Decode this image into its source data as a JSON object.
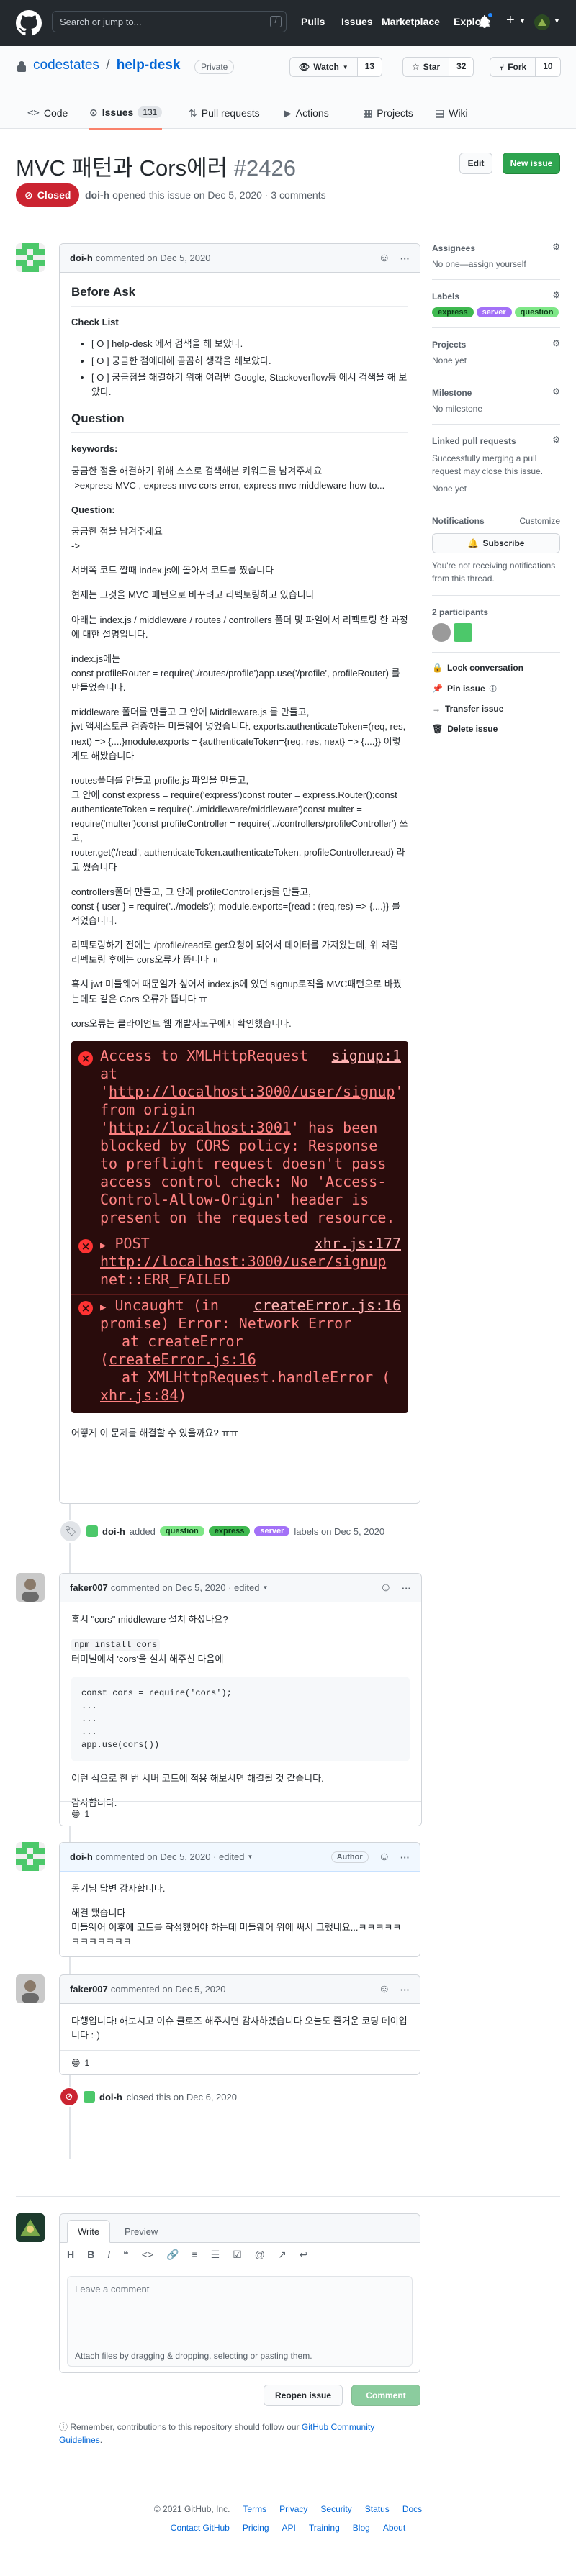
{
  "header": {
    "search_placeholder": "Search or jump to...",
    "search_key": "/",
    "nav": [
      "Pulls",
      "Issues",
      "Marketplace",
      "Explore"
    ]
  },
  "repo": {
    "owner": "codestates",
    "separator": "/",
    "name": "help-desk",
    "visibility": "Private",
    "watch_label": "Watch",
    "watch_count": "13",
    "star_label": "Star",
    "star_count": "32",
    "fork_label": "Fork",
    "fork_count": "10",
    "tabs": [
      {
        "label": "Code"
      },
      {
        "label": "Issues",
        "count": "131"
      },
      {
        "label": "Pull requests"
      },
      {
        "label": "Actions"
      },
      {
        "label": "Projects"
      },
      {
        "label": "Wiki"
      }
    ]
  },
  "issue": {
    "title": "MVC 패턴과 Cors에러",
    "number": "#2426",
    "edit_label": "Edit",
    "new_issue_label": "New issue",
    "state": "Closed",
    "author": "doi-h",
    "meta_text": "opened this issue on Dec 5, 2020 · 3 comments"
  },
  "main_comment": {
    "author": "doi-h",
    "action": "commented on Dec 5, 2020",
    "h_before": "Before Ask",
    "h_checklist": "Check List",
    "checklist": [
      "[ O ] help-desk 에서 검색을 해 보았다.",
      "[ O ] 궁금한 점에대해 곰곰히 생각을 해보았다.",
      "[ O ] 궁금점을 해결하기 위해 여러번 Google, Stackoverflow등 에서 검색을 해 보았다."
    ],
    "h_question": "Question",
    "keywords_label": "keywords:",
    "keywords_text": "궁금한 점을 해결하기 위해 스스로 검색해본 키워드를 남겨주세요",
    "keywords_arrow": "->",
    "keywords_value": "express MVC , express mvc cors error, express mvc middleware how to...",
    "question_label": "Question:",
    "q_intro": "궁금한 점을 남겨주세요",
    "q_arrow": "->",
    "paragraphs": [
      "서버쪽 코드 짤때 index.js에 몰아서 코드를 짰습니다",
      "현재는 그것을 MVC 패턴으로 바꾸려고 리펙토링하고 있습니다",
      "아래는 index.js / middleware / routes / controllers 폴더 및 파일에서 리펙토링 한 과정에 대한 설명입니다.",
      "index.js에는\nconst profileRouter = require('./routes/profile')app.use('/profile', profileRouter) 를 만들었습니다.",
      "middleware 폴더를 만들고 그 안에 Middleware.js 를 만들고,\njwt 액세스토큰 검증하는 미들웨어 넣었습니다. exports.authenticateToken=(req, res, next) => {....}module.exports = {authenticateToken={req, res, next} => {....}} 이렇게도 해봤습니다",
      "routes폴더를 만들고 profile.js 파일을 만들고,\n그 안에 const express = require('express')const router = express.Router();const authenticateToken = require('../middleware/middleware')const multer = require('multer')const profileController = require('../controllers/profileController') 쓰고,\nrouter.get('/read', authenticateToken.authenticateToken, profileController.read) 라고 썼습니다",
      "controllers폴더 만들고, 그 안에 profileController.js를 만들고,\nconst { user } = require('../models'); module.exports={read : (req,res) => {....}} 를 적었습니다.",
      "리펙토링하기 전에는 /profile/read로 get요청이 되어서 데이터를 가져왔는데, 위 처럼 리펙토링 후에는 cors오류가 뜹니다 ㅠ",
      "혹시 jwt 미들웨어 때문일가 싶어서 index.js에 있던 signup로직을 MVC패턴으로 바꿨는데도 같은 Cors 오류가 뜹니다 ㅠ",
      "cors오류는 클라이언트 웹 개발자도구에서 확인했습니다."
    ],
    "console": {
      "err1_pre": "Access to",
      "err1_link": "signup:1",
      "err1_xhr": "XMLHttpRequest at '",
      "err1_url": "http://localhost:3000/user/signup",
      "err1_mid": "' from origin '",
      "err1_origin": "http://localhost:3001",
      "err1_post": "' has been blocked by CORS policy: Response to preflight request doesn't pass access control check: No 'Access-Control-Allow-Origin' header is present on the requested resource.",
      "err2_method": "POST",
      "err2_url": "http://localhost:3000/user/signup",
      "err2_link": "xhr.js:177",
      "err2_tail": "net::ERR_FAILED",
      "err3_pre": "Uncaught (in",
      "err3_link": "createError.js:16",
      "err3_line2": "promise) Error: Network Error",
      "err3_line3": "at createError (",
      "err3_link2": "createError.js:16",
      "err3_line4": "at XMLHttpRequest.handleError (",
      "err3_link3": "xhr.js:84",
      "err3_close": ")"
    },
    "closing": "어떻게 이 문제를 해결할 수 있을까요? ㅠㅠ"
  },
  "label_event": {
    "author": "doi-h",
    "added": "added",
    "labels": [
      {
        "name": "question",
        "color": "#7ee787"
      },
      {
        "name": "express",
        "color": "#3fb950"
      },
      {
        "name": "server",
        "color": "#a371f7"
      }
    ],
    "suffix": "labels on Dec 5, 2020"
  },
  "comment2": {
    "author": "faker007",
    "action": "commented on Dec 5, 2020 · edited",
    "p1": "혹시 \"cors\" middleware 설치 하셨나요?",
    "code_inline": "npm install cors",
    "p2": "터미널에서 'cors'을 설치 해주신 다음에",
    "code_block": "const cors = require('cors');\n...\n...\n...\napp.use(cors())",
    "p3": "이런 식으로 한 번 서버 코드에 적용 해보시면 해결될 것 같습니다.",
    "p4": "감사합니다.",
    "reaction_emoji": "😄",
    "reaction_count": "1"
  },
  "comment3": {
    "author": "doi-h",
    "action": "commented on Dec 5, 2020 · edited",
    "badge": "Author",
    "p1": "동기님 답변 감사합니다.",
    "p2": "해결 됐습니다\n미들웨어 이후에 코드를 작성했어야 하는데 미들웨어 위에 써서 그랬네요...ㅋㅋㅋㅋㅋㅋㅋㅋㅋㅋㅋㅋ"
  },
  "comment4": {
    "author": "faker007",
    "action": "commented on Dec 5, 2020",
    "p1": "다행입니다! 해보시고 이슈 클로즈 해주시면 감사하겠습니다 오늘도 즐거운 코딩 데이입니다 :-)",
    "reaction_emoji": "😄",
    "reaction_count": "1"
  },
  "close_event": {
    "author": "doi-h",
    "text": "closed this on Dec 6, 2020"
  },
  "composer": {
    "tab_write": "Write",
    "tab_preview": "Preview",
    "toolbar": [
      "H",
      "B",
      "I"
    ],
    "placeholder": "Leave a comment",
    "attach_hint": "Attach files by dragging & dropping, selecting or pasting them.",
    "reopen_label": "Reopen issue",
    "comment_label": "Comment",
    "notice_pre": "Remember, contributions to this repository should follow our",
    "notice_link": "GitHub Community Guidelines",
    "notice_post": "."
  },
  "sidebar": {
    "assignees_title": "Assignees",
    "assignees_value": "No one—assign yourself",
    "labels_title": "Labels",
    "labels": [
      {
        "name": "express",
        "color": "#3fb950"
      },
      {
        "name": "server",
        "color": "#a371f7"
      },
      {
        "name": "question",
        "color": "#7ee787"
      }
    ],
    "projects_title": "Projects",
    "projects_value": "None yet",
    "milestone_title": "Milestone",
    "milestone_value": "No milestone",
    "linked_title": "Linked pull requests",
    "linked_text": "Successfully merging a pull request may close this issue.",
    "linked_value": "None yet",
    "notifications_title": "Notifications",
    "customize_label": "Customize",
    "subscribe_label": "Subscribe",
    "notif_text": "You're not receiving notifications from this thread.",
    "participants_title": "2 participants",
    "lock_label": "Lock conversation",
    "pin_label": "Pin issue",
    "transfer_label": "Transfer issue",
    "delete_label": "Delete issue"
  },
  "footer": {
    "copyright": "© 2021 GitHub, Inc.",
    "links_row1": [
      "Terms",
      "Privacy",
      "Security",
      "Status",
      "Docs"
    ],
    "links_row2": [
      "Contact GitHub",
      "Pricing",
      "API",
      "Training",
      "Blog",
      "About"
    ]
  }
}
